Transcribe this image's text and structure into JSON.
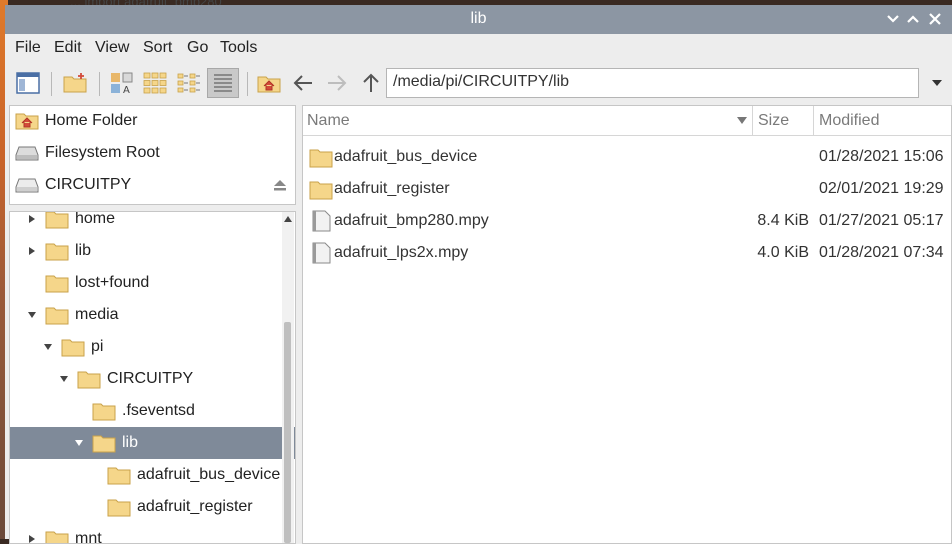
{
  "window": {
    "title": "lib"
  },
  "background": {
    "terminal_text": "... import adafruit_bmp280"
  },
  "menu": [
    "File",
    "Edit",
    "View",
    "Sort",
    "Go",
    "Tools"
  ],
  "toolbar": {
    "tools": [
      "sidebar-toggle-icon",
      "new-folder-icon",
      "icon-view-icon",
      "thumbnail-view-icon",
      "compact-view-icon",
      "list-view-icon",
      "home-icon",
      "back-arrow-icon",
      "forward-arrow-icon",
      "up-arrow-icon"
    ],
    "path": "/media/pi/CIRCUITPY/lib"
  },
  "places": [
    {
      "label": "Home Folder",
      "icon": "home-folder-icon"
    },
    {
      "label": "Filesystem Root",
      "icon": "drive-icon"
    },
    {
      "label": "CIRCUITPY",
      "icon": "drive-icon",
      "eject": "eject-icon"
    }
  ],
  "tree": [
    {
      "label": "home",
      "expander": "collapsed"
    },
    {
      "label": "lib",
      "expander": "collapsed"
    },
    {
      "label": "lost+found",
      "expander": "none"
    },
    {
      "label": "media",
      "expander": "expanded"
    },
    {
      "label": "pi",
      "expander": "expanded"
    },
    {
      "label": "CIRCUITPY",
      "expander": "expanded"
    },
    {
      "label": ".fseventsd",
      "expander": "none"
    },
    {
      "label": "lib",
      "expander": "expanded",
      "selected": true
    },
    {
      "label": "adafruit_bus_device",
      "expander": "none"
    },
    {
      "label": "adafruit_register",
      "expander": "none"
    },
    {
      "label": "mnt",
      "expander": "collapsed"
    }
  ],
  "files": {
    "columns": {
      "name": "Name",
      "size": "Size",
      "modified": "Modified"
    },
    "rows": [
      {
        "name": "adafruit_bus_device",
        "type": "folder",
        "size": "",
        "modified": "01/28/2021 15:06"
      },
      {
        "name": "adafruit_register",
        "type": "folder",
        "size": "",
        "modified": "02/01/2021 19:29"
      },
      {
        "name": "adafruit_bmp280.mpy",
        "type": "file",
        "size": "8.4 KiB",
        "modified": "01/27/2021 05:17"
      },
      {
        "name": "adafruit_lps2x.mpy",
        "type": "file",
        "size": "4.0 KiB",
        "modified": "01/28/2021 07:34"
      }
    ]
  },
  "colors": {
    "titlebar": "#8c96a3",
    "selected_row": "#7f8a99",
    "folder": "#f5d68a"
  }
}
